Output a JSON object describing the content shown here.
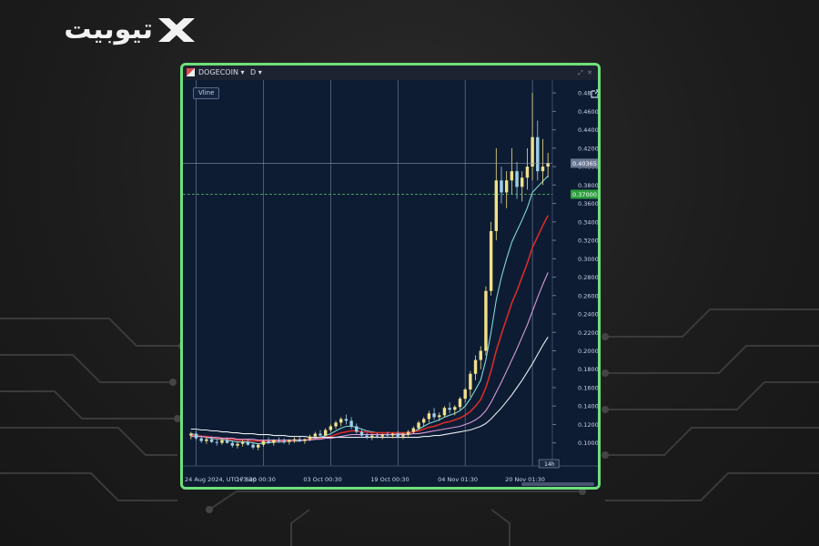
{
  "brand": {
    "logo_text": "تیوبیت"
  },
  "header": {
    "symbol": "DOGECOIN",
    "timeframe": "D",
    "vline_label": "Vline"
  },
  "colors": {
    "accent_border": "#6ee07a",
    "bull": "#f0e08a",
    "bear": "#9fd0e8",
    "ema_fast": "#7fd7d9",
    "ema_mid": "#d62b2b",
    "ema_slow": "#d99ad8",
    "ema_slowest": "#e8ecf2"
  },
  "chart_data": {
    "type": "candlestick",
    "xlabel": "",
    "ylabel": "",
    "ylim": [
      0.075,
      0.49
    ],
    "yticks": [
      "0.1000",
      "0.1200",
      "0.1400",
      "0.1600",
      "0.1800",
      "0.2000",
      "0.2200",
      "0.2400",
      "0.2600",
      "0.2800",
      "0.3000",
      "0.3200",
      "0.3400",
      "0.3600",
      "0.3800",
      "0.4000",
      "0.4200",
      "0.4400",
      "0.4600",
      "0.48"
    ],
    "xticks": [
      "24 Aug 2024, UTC+3:30",
      "17 Sep 00:30",
      "03 Oct 00:30",
      "19 Oct 00:30",
      "04 Nov 01:30",
      "20 Nov 01:30"
    ],
    "current_price": "0.40365",
    "horizontal_line_price": "0.37000",
    "badge_label": "14h",
    "candles": [
      [
        0.108,
        0.112,
        0.104,
        0.11
      ],
      [
        0.11,
        0.113,
        0.103,
        0.105
      ],
      [
        0.105,
        0.108,
        0.1,
        0.102
      ],
      [
        0.102,
        0.106,
        0.099,
        0.104
      ],
      [
        0.104,
        0.107,
        0.1,
        0.101
      ],
      [
        0.101,
        0.104,
        0.097,
        0.1
      ],
      [
        0.1,
        0.105,
        0.098,
        0.103
      ],
      [
        0.103,
        0.106,
        0.099,
        0.1
      ],
      [
        0.1,
        0.102,
        0.095,
        0.097
      ],
      [
        0.097,
        0.101,
        0.094,
        0.099
      ],
      [
        0.099,
        0.103,
        0.096,
        0.101
      ],
      [
        0.101,
        0.104,
        0.097,
        0.098
      ],
      [
        0.098,
        0.1,
        0.093,
        0.095
      ],
      [
        0.095,
        0.099,
        0.092,
        0.098
      ],
      [
        0.098,
        0.103,
        0.096,
        0.102
      ],
      [
        0.102,
        0.106,
        0.099,
        0.1
      ],
      [
        0.1,
        0.104,
        0.097,
        0.103
      ],
      [
        0.103,
        0.106,
        0.1,
        0.102
      ],
      [
        0.102,
        0.105,
        0.099,
        0.101
      ],
      [
        0.101,
        0.104,
        0.098,
        0.103
      ],
      [
        0.103,
        0.106,
        0.1,
        0.104
      ],
      [
        0.104,
        0.107,
        0.101,
        0.102
      ],
      [
        0.102,
        0.105,
        0.099,
        0.104
      ],
      [
        0.104,
        0.109,
        0.102,
        0.107
      ],
      [
        0.107,
        0.112,
        0.105,
        0.11
      ],
      [
        0.11,
        0.114,
        0.106,
        0.108
      ],
      [
        0.108,
        0.116,
        0.107,
        0.114
      ],
      [
        0.114,
        0.12,
        0.112,
        0.118
      ],
      [
        0.118,
        0.124,
        0.115,
        0.122
      ],
      [
        0.122,
        0.128,
        0.118,
        0.126
      ],
      [
        0.126,
        0.131,
        0.12,
        0.124
      ],
      [
        0.124,
        0.128,
        0.115,
        0.118
      ],
      [
        0.118,
        0.121,
        0.11,
        0.112
      ],
      [
        0.112,
        0.115,
        0.106,
        0.108
      ],
      [
        0.108,
        0.111,
        0.104,
        0.106
      ],
      [
        0.106,
        0.11,
        0.103,
        0.108
      ],
      [
        0.108,
        0.111,
        0.105,
        0.107
      ],
      [
        0.107,
        0.11,
        0.104,
        0.109
      ],
      [
        0.109,
        0.112,
        0.106,
        0.108
      ],
      [
        0.108,
        0.111,
        0.105,
        0.11
      ],
      [
        0.11,
        0.113,
        0.106,
        0.107
      ],
      [
        0.107,
        0.111,
        0.104,
        0.109
      ],
      [
        0.109,
        0.114,
        0.107,
        0.112
      ],
      [
        0.112,
        0.118,
        0.11,
        0.116
      ],
      [
        0.116,
        0.124,
        0.114,
        0.122
      ],
      [
        0.122,
        0.128,
        0.118,
        0.126
      ],
      [
        0.126,
        0.135,
        0.122,
        0.132
      ],
      [
        0.132,
        0.138,
        0.125,
        0.128
      ],
      [
        0.128,
        0.133,
        0.124,
        0.13
      ],
      [
        0.13,
        0.14,
        0.128,
        0.138
      ],
      [
        0.138,
        0.144,
        0.132,
        0.136
      ],
      [
        0.136,
        0.141,
        0.13,
        0.139
      ],
      [
        0.139,
        0.15,
        0.136,
        0.148
      ],
      [
        0.148,
        0.16,
        0.144,
        0.158
      ],
      [
        0.158,
        0.178,
        0.15,
        0.175
      ],
      [
        0.175,
        0.195,
        0.168,
        0.19
      ],
      [
        0.19,
        0.205,
        0.18,
        0.2
      ],
      [
        0.2,
        0.27,
        0.195,
        0.265
      ],
      [
        0.265,
        0.34,
        0.26,
        0.33
      ],
      [
        0.33,
        0.42,
        0.32,
        0.385
      ],
      [
        0.385,
        0.4,
        0.36,
        0.372
      ],
      [
        0.372,
        0.395,
        0.355,
        0.385
      ],
      [
        0.385,
        0.42,
        0.37,
        0.395
      ],
      [
        0.395,
        0.405,
        0.365,
        0.378
      ],
      [
        0.378,
        0.395,
        0.362,
        0.388
      ],
      [
        0.388,
        0.42,
        0.375,
        0.4
      ],
      [
        0.4,
        0.48,
        0.385,
        0.432
      ],
      [
        0.432,
        0.45,
        0.385,
        0.395
      ],
      [
        0.395,
        0.43,
        0.38,
        0.4
      ],
      [
        0.4,
        0.415,
        0.388,
        0.404
      ]
    ],
    "series": [
      {
        "color_key": "ema_fast",
        "values": [
          0.11,
          0.109,
          0.107,
          0.106,
          0.105,
          0.104,
          0.104,
          0.103,
          0.102,
          0.101,
          0.101,
          0.101,
          0.1,
          0.099,
          0.1,
          0.1,
          0.101,
          0.101,
          0.101,
          0.102,
          0.102,
          0.102,
          0.103,
          0.104,
          0.105,
          0.106,
          0.108,
          0.11,
          0.113,
          0.116,
          0.118,
          0.118,
          0.117,
          0.115,
          0.113,
          0.112,
          0.111,
          0.111,
          0.111,
          0.111,
          0.11,
          0.11,
          0.111,
          0.112,
          0.115,
          0.118,
          0.121,
          0.123,
          0.125,
          0.128,
          0.13,
          0.132,
          0.135,
          0.14,
          0.148,
          0.158,
          0.168,
          0.19,
          0.22,
          0.255,
          0.28,
          0.3,
          0.318,
          0.33,
          0.342,
          0.355,
          0.372,
          0.378,
          0.384,
          0.39
        ]
      },
      {
        "color_key": "ema_mid",
        "values": [
          0.108,
          0.108,
          0.107,
          0.107,
          0.106,
          0.105,
          0.105,
          0.104,
          0.104,
          0.103,
          0.103,
          0.103,
          0.102,
          0.102,
          0.102,
          0.102,
          0.102,
          0.102,
          0.102,
          0.102,
          0.103,
          0.103,
          0.103,
          0.104,
          0.104,
          0.105,
          0.106,
          0.107,
          0.109,
          0.111,
          0.112,
          0.113,
          0.113,
          0.112,
          0.112,
          0.111,
          0.111,
          0.111,
          0.111,
          0.111,
          0.111,
          0.111,
          0.111,
          0.112,
          0.113,
          0.115,
          0.117,
          0.118,
          0.12,
          0.122,
          0.123,
          0.125,
          0.127,
          0.13,
          0.134,
          0.14,
          0.147,
          0.16,
          0.178,
          0.2,
          0.218,
          0.235,
          0.252,
          0.265,
          0.28,
          0.295,
          0.312,
          0.324,
          0.336,
          0.347
        ]
      },
      {
        "color_key": "ema_slow",
        "values": [
          0.107,
          0.107,
          0.107,
          0.106,
          0.106,
          0.106,
          0.105,
          0.105,
          0.105,
          0.104,
          0.104,
          0.104,
          0.104,
          0.103,
          0.103,
          0.103,
          0.103,
          0.103,
          0.103,
          0.103,
          0.103,
          0.103,
          0.103,
          0.103,
          0.104,
          0.104,
          0.105,
          0.105,
          0.106,
          0.107,
          0.108,
          0.109,
          0.109,
          0.109,
          0.109,
          0.109,
          0.109,
          0.109,
          0.109,
          0.109,
          0.109,
          0.109,
          0.109,
          0.11,
          0.11,
          0.111,
          0.112,
          0.113,
          0.114,
          0.115,
          0.116,
          0.117,
          0.118,
          0.12,
          0.122,
          0.125,
          0.129,
          0.135,
          0.144,
          0.155,
          0.166,
          0.178,
          0.19,
          0.202,
          0.215,
          0.228,
          0.243,
          0.258,
          0.272,
          0.285
        ]
      },
      {
        "color_key": "ema_slowest",
        "values": [
          0.115,
          0.115,
          0.114,
          0.114,
          0.113,
          0.113,
          0.112,
          0.112,
          0.111,
          0.111,
          0.11,
          0.11,
          0.11,
          0.109,
          0.109,
          0.109,
          0.108,
          0.108,
          0.108,
          0.107,
          0.107,
          0.107,
          0.107,
          0.106,
          0.106,
          0.106,
          0.106,
          0.106,
          0.106,
          0.106,
          0.106,
          0.106,
          0.106,
          0.106,
          0.106,
          0.106,
          0.106,
          0.106,
          0.106,
          0.106,
          0.106,
          0.106,
          0.106,
          0.106,
          0.106,
          0.107,
          0.107,
          0.108,
          0.108,
          0.109,
          0.11,
          0.111,
          0.112,
          0.113,
          0.114,
          0.116,
          0.118,
          0.121,
          0.126,
          0.132,
          0.138,
          0.145,
          0.152,
          0.16,
          0.168,
          0.177,
          0.186,
          0.196,
          0.206,
          0.215
        ]
      }
    ]
  }
}
